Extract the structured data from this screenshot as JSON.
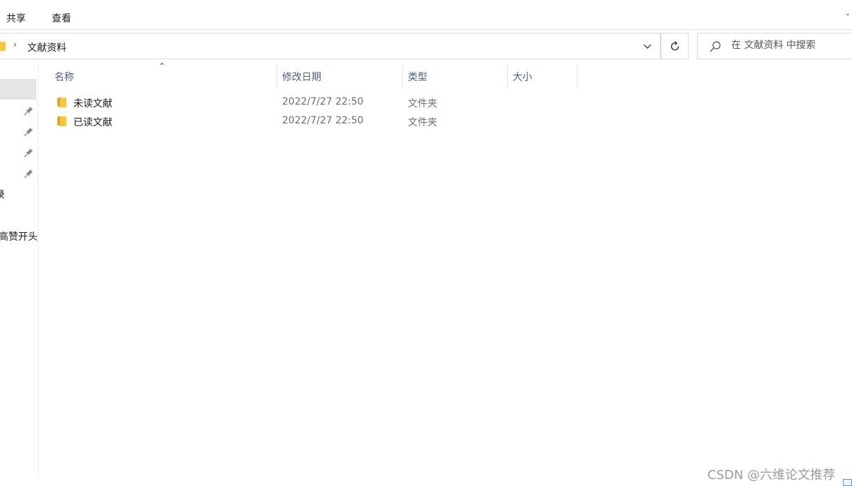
{
  "ribbon": {
    "tabs": [
      "共享",
      "查看"
    ]
  },
  "address": {
    "crumb": "文献资料"
  },
  "search": {
    "placeholder": "在 文献资料 中搜索"
  },
  "nav": {
    "items": [
      "录",
      "高赞开头"
    ]
  },
  "columns": {
    "name": "名称",
    "date": "修改日期",
    "type": "类型",
    "size": "大小"
  },
  "files": [
    {
      "name": "未读文献",
      "modified": "2022/7/27 22:50",
      "type": "文件夹"
    },
    {
      "name": "已读文献",
      "modified": "2022/7/27 22:50",
      "type": "文件夹"
    }
  ],
  "watermark": "CSDN @六维论文推荐",
  "colors": {
    "folder": "#f4c642",
    "folder_dark": "#e0a818",
    "header_text": "#4c607a"
  },
  "icons": [
    "folder-icon",
    "chevron-right-icon",
    "chevron-down-icon",
    "refresh-icon",
    "search-icon",
    "pin-icon",
    "sort-up-icon"
  ]
}
